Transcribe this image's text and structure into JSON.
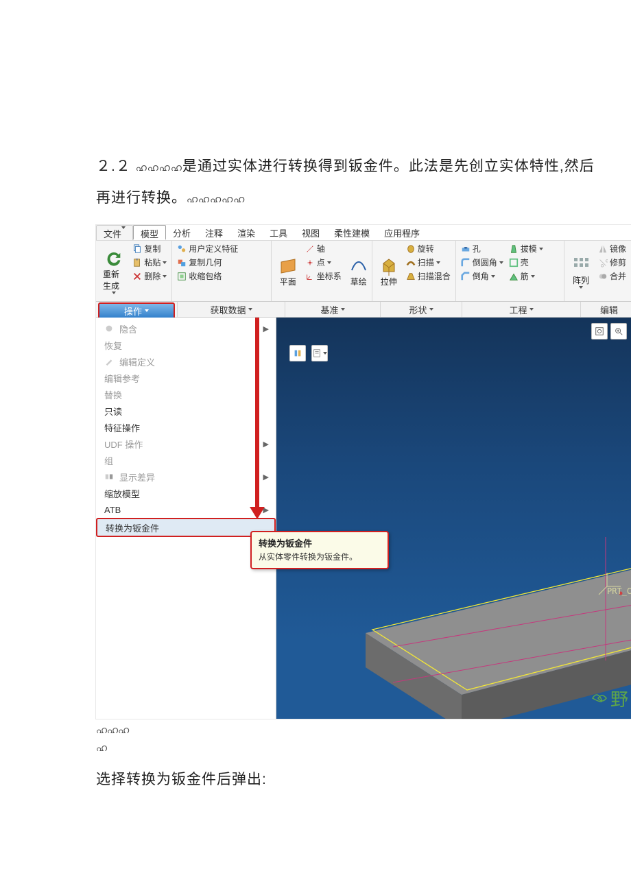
{
  "doc": {
    "para1a": "２.２",
    "para1b": "是通过实体进行转换得到钣金件。此法是先创立实体特性,然后再进行转换。",
    "decor1": "ഹഹഹഹ",
    "decor2": "ഹഹഹഹഹ",
    "spacer1": "ഹഹഹ",
    "spacer2": "ഹ",
    "para2": "选择转换为钣金件后弹出:"
  },
  "tabs": {
    "file": "文件",
    "model": "模型",
    "analysis": "分析",
    "annotate": "注释",
    "render": "渲染",
    "tools": "工具",
    "view": "视图",
    "flex": "柔性建模",
    "app": "应用程序"
  },
  "ribbon": {
    "regen": "重新生成",
    "copy": "复制",
    "paste": "粘贴",
    "delete": "删除",
    "udf": "用户定义特征",
    "copygeo": "复制几何",
    "shrink": "收缩包络",
    "plane": "平面",
    "axis": "轴",
    "point": "点",
    "csys": "坐标系",
    "sketch": "草绘",
    "extrude": "拉伸",
    "revolve": "旋转",
    "sweep": "扫描",
    "sweepblend": "扫描混合",
    "hole": "孔",
    "round": "倒圆角",
    "chamfer": "倒角",
    "draft": "拔模",
    "shell": "壳",
    "rib": "筋",
    "pattern": "阵列",
    "mirror": "镜像",
    "trim": "修剪",
    "merge": "合并"
  },
  "groups": {
    "operate": "操作",
    "getdata": "获取数据",
    "datum": "基准",
    "shape": "形状",
    "eng": "工程",
    "edit": "编辑"
  },
  "menu": {
    "hide": "隐含",
    "resume": "恢复",
    "editdef": "编辑定义",
    "editref": "编辑参考",
    "replace": "替换",
    "readonly": "只读",
    "featop": "特征操作",
    "udfop": "UDF 操作",
    "group": "组",
    "showdiff": "显示差异",
    "scale": "缩放模型",
    "atb": "ATB",
    "convert": "转换为钣金件"
  },
  "tooltip": {
    "title": "转换为钣金件",
    "body": "从实体零件转换为钣金件。"
  },
  "canvas": {
    "csys": "PRT_CSYS_DEF"
  },
  "watermark": "野"
}
